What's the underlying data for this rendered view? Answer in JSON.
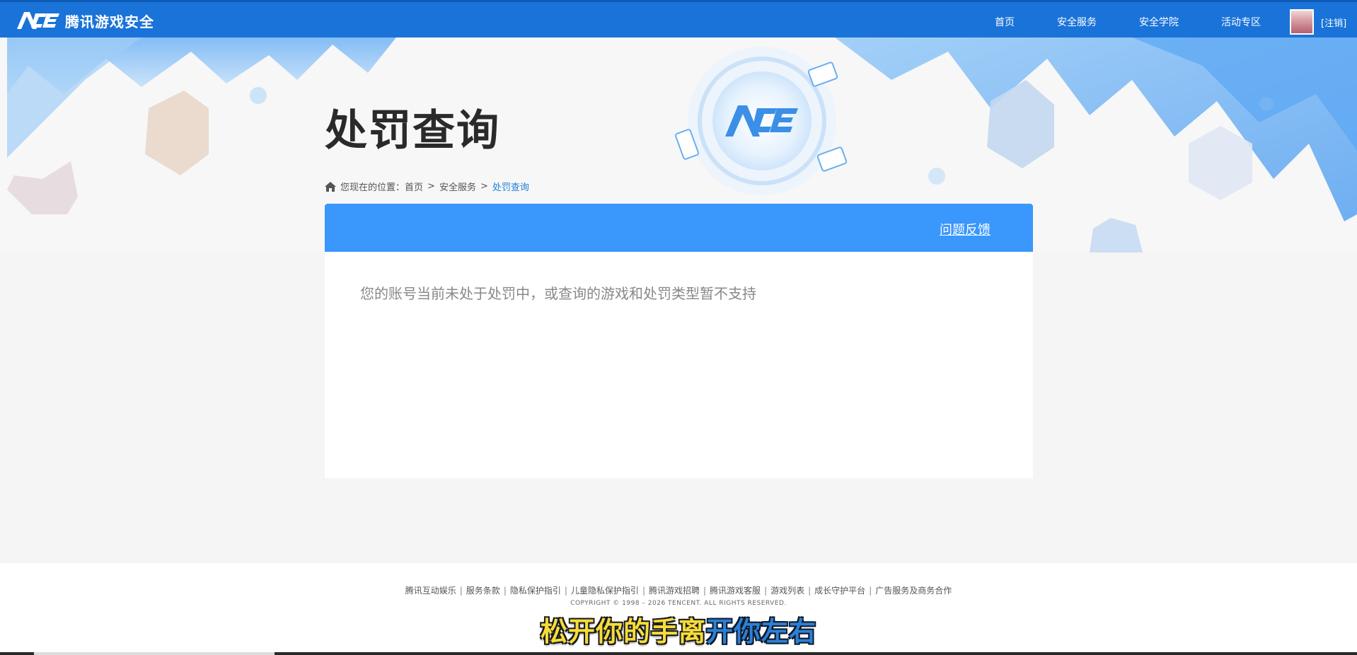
{
  "header": {
    "logo_text": "腾讯游戏安全",
    "nav": [
      {
        "label": "首页"
      },
      {
        "label": "安全服务"
      },
      {
        "label": "安全学院"
      },
      {
        "label": "活动专区"
      }
    ],
    "logout_label": "[注销]"
  },
  "main": {
    "title": "处罚查询",
    "breadcrumb": {
      "prefix": "您现在的位置：",
      "items": [
        "首页",
        "安全服务",
        "处罚查询"
      ],
      "separator": ">"
    },
    "panel": {
      "feedback_label": "问题反馈",
      "message": "您的账号当前未处于处罚中，或查询的游戏和处罚类型暂不支持"
    }
  },
  "footer": {
    "links": [
      "腾讯互动娱乐",
      "服务条款",
      "隐私保护指引",
      "儿童隐私保护指引",
      "腾讯游戏招聘",
      "腾讯游戏客服",
      "游戏列表",
      "成长守护平台",
      "广告服务及商务合作"
    ],
    "copyright": "COPYRIGHT © 1998 – 2026 TENCENT. ALL RIGHTS RESERVED.",
    "subtitle_part1": "松开你的手离",
    "subtitle_part2": "开你左右"
  },
  "colors": {
    "nav_bg": "#1a73d9",
    "panel_header": "#3a97fc",
    "breadcrumb_active": "#1f7fd9"
  }
}
